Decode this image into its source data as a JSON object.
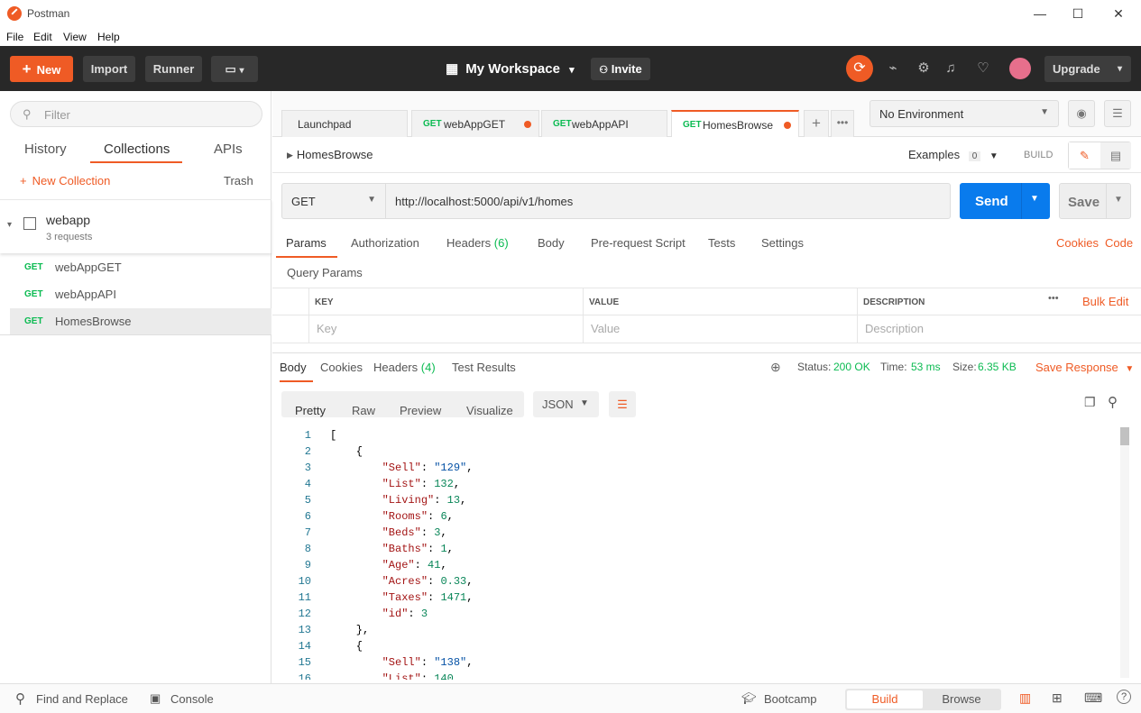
{
  "window": {
    "title": "Postman",
    "minimize": "—",
    "maximize": "☐",
    "close": "✕"
  },
  "menu": [
    "File",
    "Edit",
    "View",
    "Help"
  ],
  "header": {
    "new_label": "New",
    "import_label": "Import",
    "runner_label": "Runner",
    "workspace": "My Workspace",
    "invite": "Invite",
    "upgrade": "Upgrade"
  },
  "sidebar": {
    "filter_placeholder": "Filter",
    "tabs": [
      "History",
      "Collections",
      "APIs"
    ],
    "new_collection": "New Collection",
    "trash": "Trash",
    "collection": {
      "name": "webapp",
      "count": "3 requests"
    },
    "requests": [
      {
        "method": "GET",
        "name": "webAppGET"
      },
      {
        "method": "GET",
        "name": "webAppAPI"
      },
      {
        "method": "GET",
        "name": "HomesBrowse"
      }
    ]
  },
  "tabs": [
    {
      "method": "",
      "name": "Launchpad"
    },
    {
      "method": "GET",
      "name": "webAppGET"
    },
    {
      "method": "GET",
      "name": "webAppAPI"
    },
    {
      "method": "GET",
      "name": "HomesBrowse"
    }
  ],
  "environment": "No Environment",
  "request": {
    "name": "HomesBrowse",
    "examples_label": "Examples",
    "examples_count": "0",
    "build_label": "BUILD",
    "method": "GET",
    "url": "http://localhost:5000/api/v1/homes",
    "send": "Send",
    "save": "Save",
    "tabs": [
      "Params",
      "Authorization",
      "Headers",
      "(6)",
      "Body",
      "Pre-request Script",
      "Tests",
      "Settings"
    ],
    "cookies": "Cookies",
    "code": "Code",
    "query_title": "Query Params",
    "columns": [
      "KEY",
      "VALUE",
      "DESCRIPTION"
    ],
    "bulk_edit": "Bulk Edit",
    "placeholders": [
      "Key",
      "Value",
      "Description"
    ]
  },
  "response": {
    "tabs": [
      "Body",
      "Cookies",
      "Headers",
      "(4)",
      "Test Results"
    ],
    "status_label": "Status:",
    "status": "200 OK",
    "time_label": "Time:",
    "time": "53 ms",
    "size_label": "Size:",
    "size": "6.35 KB",
    "save_response": "Save Response",
    "views": [
      "Pretty",
      "Raw",
      "Preview",
      "Visualize"
    ],
    "format": "JSON",
    "lines": [
      {
        "n": "1",
        "t": "["
      },
      {
        "n": "2",
        "t": "    {"
      },
      {
        "n": "3",
        "t": "        \"Sell\": \"129\","
      },
      {
        "n": "4",
        "t": "        \"List\": 132,"
      },
      {
        "n": "5",
        "t": "        \"Living\": 13,"
      },
      {
        "n": "6",
        "t": "        \"Rooms\": 6,"
      },
      {
        "n": "7",
        "t": "        \"Beds\": 3,"
      },
      {
        "n": "8",
        "t": "        \"Baths\": 1,"
      },
      {
        "n": "9",
        "t": "        \"Age\": 41,"
      },
      {
        "n": "10",
        "t": "        \"Acres\": 0.33,"
      },
      {
        "n": "11",
        "t": "        \"Taxes\": 1471,"
      },
      {
        "n": "12",
        "t": "        \"id\": 3"
      },
      {
        "n": "13",
        "t": "    },"
      },
      {
        "n": "14",
        "t": "    {"
      },
      {
        "n": "15",
        "t": "        \"Sell\": \"138\","
      },
      {
        "n": "16",
        "t": "        \"List\": 140,"
      }
    ]
  },
  "statusbar": {
    "find_replace": "Find and Replace",
    "console": "Console",
    "bootcamp": "Bootcamp",
    "build": "Build",
    "browse": "Browse"
  },
  "colors": {
    "accent": "#ef5b25",
    "send": "#097bed",
    "get": "#0cbb52"
  }
}
